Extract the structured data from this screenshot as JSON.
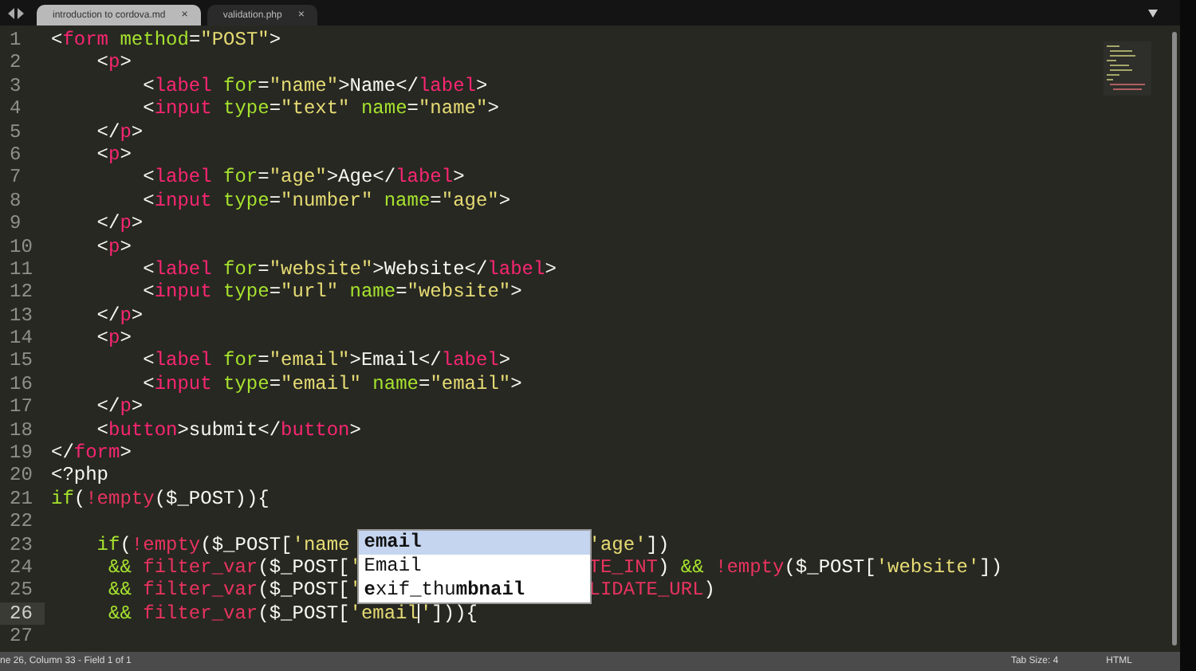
{
  "tabs": [
    {
      "label": "introduction to cordova.md",
      "close": "×",
      "selected": true
    },
    {
      "label": "validation.php",
      "close": "×",
      "selected": false
    }
  ],
  "lines": [
    {
      "n": "1",
      "current": false,
      "tokens": [
        {
          "kind": "plain",
          "text": "<"
        },
        {
          "kind": "tag",
          "text": "form"
        },
        {
          "kind": "attr",
          "text": " method"
        },
        {
          "kind": "plain",
          "text": "="
        },
        {
          "kind": "string",
          "text": "\"POST\""
        },
        {
          "kind": "plain",
          "text": ">"
        }
      ]
    },
    {
      "n": "2",
      "current": false,
      "tokens": [
        {
          "kind": "plain",
          "text": "    <"
        },
        {
          "kind": "tag",
          "text": "p"
        },
        {
          "kind": "plain",
          "text": ">"
        }
      ]
    },
    {
      "n": "3",
      "current": false,
      "tokens": [
        {
          "kind": "plain",
          "text": "        <"
        },
        {
          "kind": "tag",
          "text": "label"
        },
        {
          "kind": "attr",
          "text": " for"
        },
        {
          "kind": "plain",
          "text": "="
        },
        {
          "kind": "string",
          "text": "\"name\""
        },
        {
          "kind": "plain",
          "text": ">Name</"
        },
        {
          "kind": "tag",
          "text": "label"
        },
        {
          "kind": "plain",
          "text": ">"
        }
      ]
    },
    {
      "n": "4",
      "current": false,
      "tokens": [
        {
          "kind": "plain",
          "text": "        <"
        },
        {
          "kind": "tag",
          "text": "input"
        },
        {
          "kind": "attr",
          "text": " type"
        },
        {
          "kind": "plain",
          "text": "="
        },
        {
          "kind": "string",
          "text": "\"text\""
        },
        {
          "kind": "attr",
          "text": " name"
        },
        {
          "kind": "plain",
          "text": "="
        },
        {
          "kind": "string",
          "text": "\"name\""
        },
        {
          "kind": "plain",
          "text": ">"
        }
      ]
    },
    {
      "n": "5",
      "current": false,
      "tokens": [
        {
          "kind": "plain",
          "text": "    </"
        },
        {
          "kind": "tag",
          "text": "p"
        },
        {
          "kind": "plain",
          "text": ">"
        }
      ]
    },
    {
      "n": "6",
      "current": false,
      "tokens": [
        {
          "kind": "plain",
          "text": "    <"
        },
        {
          "kind": "tag",
          "text": "p"
        },
        {
          "kind": "plain",
          "text": ">"
        }
      ]
    },
    {
      "n": "7",
      "current": false,
      "tokens": [
        {
          "kind": "plain",
          "text": "        <"
        },
        {
          "kind": "tag",
          "text": "label"
        },
        {
          "kind": "attr",
          "text": " for"
        },
        {
          "kind": "plain",
          "text": "="
        },
        {
          "kind": "string",
          "text": "\"age\""
        },
        {
          "kind": "plain",
          "text": ">Age</"
        },
        {
          "kind": "tag",
          "text": "label"
        },
        {
          "kind": "plain",
          "text": ">"
        }
      ]
    },
    {
      "n": "8",
      "current": false,
      "tokens": [
        {
          "kind": "plain",
          "text": "        <"
        },
        {
          "kind": "tag",
          "text": "input"
        },
        {
          "kind": "attr",
          "text": " type"
        },
        {
          "kind": "plain",
          "text": "="
        },
        {
          "kind": "string",
          "text": "\"number\""
        },
        {
          "kind": "attr",
          "text": " name"
        },
        {
          "kind": "plain",
          "text": "="
        },
        {
          "kind": "string",
          "text": "\"age\""
        },
        {
          "kind": "plain",
          "text": ">"
        }
      ]
    },
    {
      "n": "9",
      "current": false,
      "tokens": [
        {
          "kind": "plain",
          "text": "    </"
        },
        {
          "kind": "tag",
          "text": "p"
        },
        {
          "kind": "plain",
          "text": ">"
        }
      ]
    },
    {
      "n": "10",
      "current": false,
      "tokens": [
        {
          "kind": "plain",
          "text": "    <"
        },
        {
          "kind": "tag",
          "text": "p"
        },
        {
          "kind": "plain",
          "text": ">"
        }
      ]
    },
    {
      "n": "11",
      "current": false,
      "tokens": [
        {
          "kind": "plain",
          "text": "        <"
        },
        {
          "kind": "tag",
          "text": "label"
        },
        {
          "kind": "attr",
          "text": " for"
        },
        {
          "kind": "plain",
          "text": "="
        },
        {
          "kind": "string",
          "text": "\"website\""
        },
        {
          "kind": "plain",
          "text": ">Website</"
        },
        {
          "kind": "tag",
          "text": "label"
        },
        {
          "kind": "plain",
          "text": ">"
        }
      ]
    },
    {
      "n": "12",
      "current": false,
      "tokens": [
        {
          "kind": "plain",
          "text": "        <"
        },
        {
          "kind": "tag",
          "text": "input"
        },
        {
          "kind": "attr",
          "text": " type"
        },
        {
          "kind": "plain",
          "text": "="
        },
        {
          "kind": "string",
          "text": "\"url\""
        },
        {
          "kind": "attr",
          "text": " name"
        },
        {
          "kind": "plain",
          "text": "="
        },
        {
          "kind": "string",
          "text": "\"website\""
        },
        {
          "kind": "plain",
          "text": ">"
        }
      ]
    },
    {
      "n": "13",
      "current": false,
      "tokens": [
        {
          "kind": "plain",
          "text": "    </"
        },
        {
          "kind": "tag",
          "text": "p"
        },
        {
          "kind": "plain",
          "text": ">"
        }
      ]
    },
    {
      "n": "14",
      "current": false,
      "tokens": [
        {
          "kind": "plain",
          "text": "    <"
        },
        {
          "kind": "tag",
          "text": "p"
        },
        {
          "kind": "plain",
          "text": ">"
        }
      ]
    },
    {
      "n": "15",
      "current": false,
      "tokens": [
        {
          "kind": "plain",
          "text": "        <"
        },
        {
          "kind": "tag",
          "text": "label"
        },
        {
          "kind": "attr",
          "text": " for"
        },
        {
          "kind": "plain",
          "text": "="
        },
        {
          "kind": "string",
          "text": "\"email\""
        },
        {
          "kind": "plain",
          "text": ">Email</"
        },
        {
          "kind": "tag",
          "text": "label"
        },
        {
          "kind": "plain",
          "text": ">"
        }
      ]
    },
    {
      "n": "16",
      "current": false,
      "tokens": [
        {
          "kind": "plain",
          "text": "        <"
        },
        {
          "kind": "tag",
          "text": "input"
        },
        {
          "kind": "attr",
          "text": " type"
        },
        {
          "kind": "plain",
          "text": "="
        },
        {
          "kind": "string",
          "text": "\"email\""
        },
        {
          "kind": "attr",
          "text": " name"
        },
        {
          "kind": "plain",
          "text": "="
        },
        {
          "kind": "string",
          "text": "\"email\""
        },
        {
          "kind": "plain",
          "text": ">"
        }
      ]
    },
    {
      "n": "17",
      "current": false,
      "tokens": [
        {
          "kind": "plain",
          "text": "    </"
        },
        {
          "kind": "tag",
          "text": "p"
        },
        {
          "kind": "plain",
          "text": ">"
        }
      ]
    },
    {
      "n": "18",
      "current": false,
      "tokens": [
        {
          "kind": "plain",
          "text": "    <"
        },
        {
          "kind": "tag",
          "text": "button"
        },
        {
          "kind": "plain",
          "text": ">submit</"
        },
        {
          "kind": "tag",
          "text": "button"
        },
        {
          "kind": "plain",
          "text": ">"
        }
      ]
    },
    {
      "n": "19",
      "current": false,
      "tokens": [
        {
          "kind": "plain",
          "text": "</"
        },
        {
          "kind": "tag",
          "text": "form"
        },
        {
          "kind": "plain",
          "text": ">"
        }
      ]
    },
    {
      "n": "20",
      "current": false,
      "tokens": [
        {
          "kind": "plain",
          "text": "<?php"
        }
      ]
    },
    {
      "n": "21",
      "current": false,
      "tokens": [
        {
          "kind": "control",
          "text": "if"
        },
        {
          "kind": "plain",
          "text": "("
        },
        {
          "kind": "keyword",
          "text": "!empty"
        },
        {
          "kind": "plain",
          "text": "($_POST)){"
        }
      ]
    },
    {
      "n": "22",
      "current": false
    },
    {
      "n": "23",
      "current": false,
      "tokens": [
        {
          "kind": "control",
          "text": "    if"
        },
        {
          "kind": "plain",
          "text": "("
        },
        {
          "kind": "keyword",
          "text": "!empty"
        },
        {
          "kind": "plain",
          "text": "($_POST["
        },
        {
          "kind": "string",
          "text": "'name"
        }
      ],
      "after_popup": [
        {
          "kind": "string",
          "text": "'age'"
        },
        {
          "kind": "plain",
          "text": "])"
        }
      ]
    },
    {
      "n": "24",
      "current": false,
      "tokens": [
        {
          "kind": "control",
          "text": "     &&"
        },
        {
          "kind": "keyword",
          "text": " filter_var"
        },
        {
          "kind": "plain",
          "text": "($_POST["
        },
        {
          "kind": "string",
          "text": "'"
        }
      ],
      "after_popup": [
        {
          "kind": "keyword",
          "text": "TE_INT"
        },
        {
          "kind": "plain",
          "text": ") "
        },
        {
          "kind": "control",
          "text": "&&"
        },
        {
          "kind": "keyword",
          "text": " !empty"
        },
        {
          "kind": "plain",
          "text": "($_POST["
        },
        {
          "kind": "string",
          "text": "'website'"
        },
        {
          "kind": "plain",
          "text": "])"
        }
      ]
    },
    {
      "n": "25",
      "current": false,
      "tokens": [
        {
          "kind": "control",
          "text": "     &&"
        },
        {
          "kind": "keyword",
          "text": " filter_var"
        },
        {
          "kind": "plain",
          "text": "($_POST["
        },
        {
          "kind": "string",
          "text": "'"
        }
      ],
      "after_popup": [
        {
          "kind": "keyword",
          "text": "LIDATE_URL"
        },
        {
          "kind": "plain",
          "text": ")"
        }
      ]
    },
    {
      "n": "26",
      "current": true,
      "tokens": [
        {
          "kind": "control",
          "text": "     &&"
        },
        {
          "kind": "keyword",
          "text": " filter_var"
        },
        {
          "kind": "plain",
          "text": "($_POST["
        },
        {
          "kind": "string",
          "text": "'email"
        },
        {
          "kind": "caret"
        },
        {
          "kind": "string",
          "text": "'"
        },
        {
          "kind": "plain",
          "text": "])){"
        }
      ]
    },
    {
      "n": "27",
      "current": false
    }
  ],
  "popup": {
    "items": [
      {
        "label": "email",
        "selected": true
      },
      {
        "label": "Email",
        "selected": false
      },
      {
        "label": "**e**xif_thu**mbnail**",
        "selected": false
      }
    ]
  },
  "status_bar": {
    "position": "ne 26, Column 33 - Field 1 of 1",
    "tab_size": "Tab Size: 4",
    "syntax": "HTML"
  }
}
